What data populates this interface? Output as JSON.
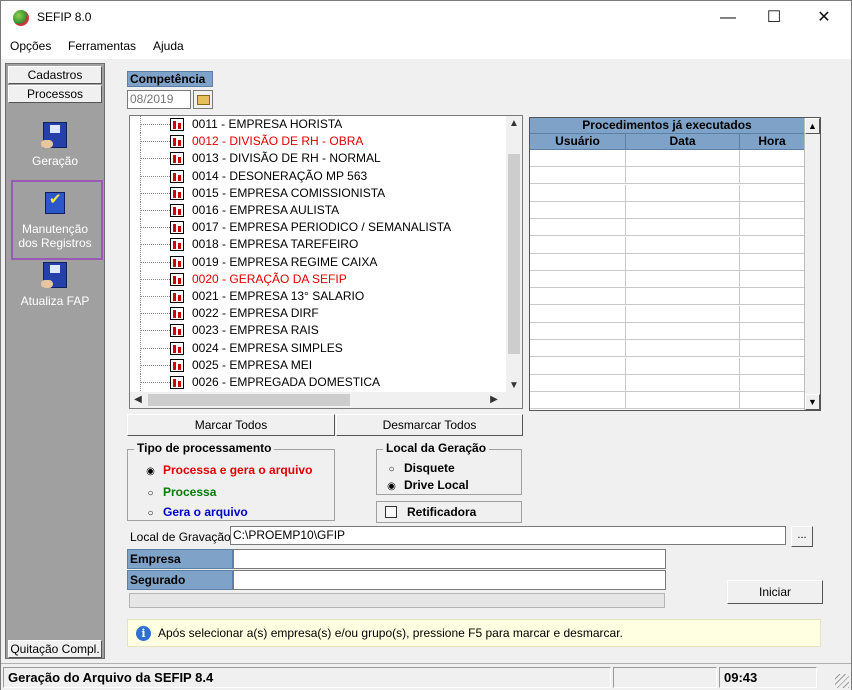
{
  "window": {
    "title": "SEFIP 8.0",
    "minimize": "—",
    "maximize": "☐",
    "close": "✕"
  },
  "menu": {
    "items": [
      {
        "label": "Opções"
      },
      {
        "label": "Ferramentas"
      },
      {
        "label": "Ajuda"
      }
    ]
  },
  "sidebar": {
    "tab_cadastros": "Cadastros",
    "tab_processos": "Processos",
    "items": [
      {
        "label": "Geração",
        "icon": "disk-hand-icon"
      },
      {
        "label": "Manutenção dos Registros",
        "icon": "checklist-icon",
        "selected": true
      },
      {
        "label": "Atualiza FAP",
        "icon": "disk-hand-icon"
      }
    ],
    "quitacao": "Quitação Compl."
  },
  "competencia": {
    "label": "Competência",
    "value": "08/2019"
  },
  "companies": [
    {
      "label": "0011 - EMPRESA HORISTA",
      "highlight": false
    },
    {
      "label": "0012 - DIVISÃO DE RH - OBRA",
      "highlight": true
    },
    {
      "label": "0013 - DIVISÃO DE RH - NORMAL",
      "highlight": false
    },
    {
      "label": "0014 - DESONERAÇÃO MP 563",
      "highlight": false
    },
    {
      "label": "0015 - EMPRESA COMISSIONISTA",
      "highlight": false
    },
    {
      "label": "0016 - EMPRESA AULISTA",
      "highlight": false
    },
    {
      "label": "0017 - EMPRESA PERIODICO / SEMANALISTA",
      "highlight": false
    },
    {
      "label": "0018 - EMPRESA TAREFEIRO",
      "highlight": false
    },
    {
      "label": "0019 - EMPRESA REGIME CAIXA",
      "highlight": false
    },
    {
      "label": "0020 - GERAÇÃO DA SEFIP",
      "highlight": true
    },
    {
      "label": "0021 - EMPRESA 13° SALARIO",
      "highlight": false
    },
    {
      "label": "0022 - EMPRESA DIRF",
      "highlight": false
    },
    {
      "label": "0023 - EMPRESA RAIS",
      "highlight": false
    },
    {
      "label": "0024 - EMPRESA SIMPLES",
      "highlight": false
    },
    {
      "label": "0025 - EMPRESA MEI",
      "highlight": false
    },
    {
      "label": "0026 - EMPREGADA DOMESTICA",
      "highlight": false
    }
  ],
  "procedures": {
    "title": "Procedimentos já executados",
    "columns": [
      "Usuário",
      "Data",
      "Hora"
    ],
    "rows": []
  },
  "buttons": {
    "marcar_todos": "Marcar Todos",
    "desmarcar_todos": "Desmarcar Todos",
    "iniciar": "Iniciar",
    "ellipsis": "..."
  },
  "tipo_processamento": {
    "title": "Tipo de processamento",
    "options": [
      {
        "label": "Processa e gera o arquivo",
        "color": "#e00000",
        "selected": true
      },
      {
        "label": "Processa",
        "color": "#007a00",
        "selected": false
      },
      {
        "label": "Gera o arquivo",
        "color": "#0000c8",
        "selected": false
      }
    ]
  },
  "local_geracao": {
    "title": "Local da Geração",
    "options": [
      {
        "label": "Disquete",
        "selected": false
      },
      {
        "label": "Drive Local",
        "selected": true
      }
    ]
  },
  "retificadora": {
    "label": "Retificadora",
    "checked": false
  },
  "gravacao": {
    "label": "Local de Gravação",
    "path": "C:\\PROEMP10\\GFIP"
  },
  "fields": {
    "empresa_label": "Empresa",
    "empresa_value": "",
    "segurado_label": "Segurado",
    "segurado_value": ""
  },
  "info": {
    "text": "Após selecionar a(s) empresa(s) e/ou grupo(s), pressione F5 para marcar e desmarcar."
  },
  "status": {
    "message": "Geração do Arquivo da SEFIP 8.4",
    "time": "09:43"
  },
  "colors": {
    "header_blue": "#7fa3c8",
    "sidebar_gray": "#a0a0a0",
    "highlight_red": "#e00000",
    "selection_purple": "#9b59b6",
    "info_bg": "#ffffe1"
  }
}
